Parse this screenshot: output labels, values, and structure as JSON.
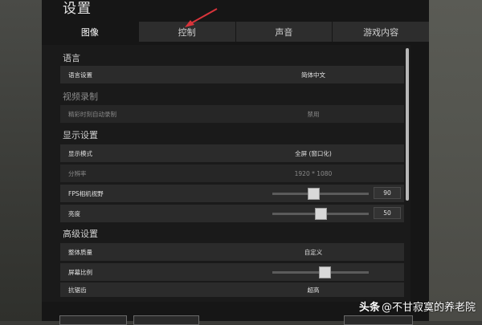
{
  "window": {
    "title": "设置"
  },
  "tabs": [
    {
      "label": "图像",
      "active": true
    },
    {
      "label": "控制",
      "active": false
    },
    {
      "label": "声音",
      "active": false
    },
    {
      "label": "游戏内容",
      "active": false
    }
  ],
  "sections": {
    "language": "语言",
    "video_record": "视频录制",
    "display": "显示设置",
    "advanced": "高级设置"
  },
  "rows": {
    "language_setting": {
      "label": "语言设置",
      "value": "简体中文"
    },
    "highlight_record": {
      "label": "精彩时刻自动录制",
      "value": "禁用"
    },
    "display_mode": {
      "label": "显示模式",
      "value": "全屏 (窗口化)"
    },
    "resolution": {
      "label": "分辨率",
      "value": "1920 * 1080"
    },
    "fps_fov": {
      "label": "FPS相机视野",
      "value": "90",
      "level": 0.42
    },
    "brightness": {
      "label": "亮度",
      "value": "50",
      "level": 0.5
    },
    "overall_quality": {
      "label": "整体质量",
      "value": "自定义"
    },
    "screen_scale": {
      "label": "屏幕比例",
      "level": 0.55
    },
    "anti_aliasing": {
      "label": "抗锯齿",
      "value": "超高"
    }
  },
  "watermark": {
    "brand": "头条",
    "handle": "@不甘寂寞的养老院"
  },
  "colors": {
    "accent_arrow": "#d9343b",
    "panel_bg": "#161616",
    "row_bg": "#2b2b2b"
  }
}
